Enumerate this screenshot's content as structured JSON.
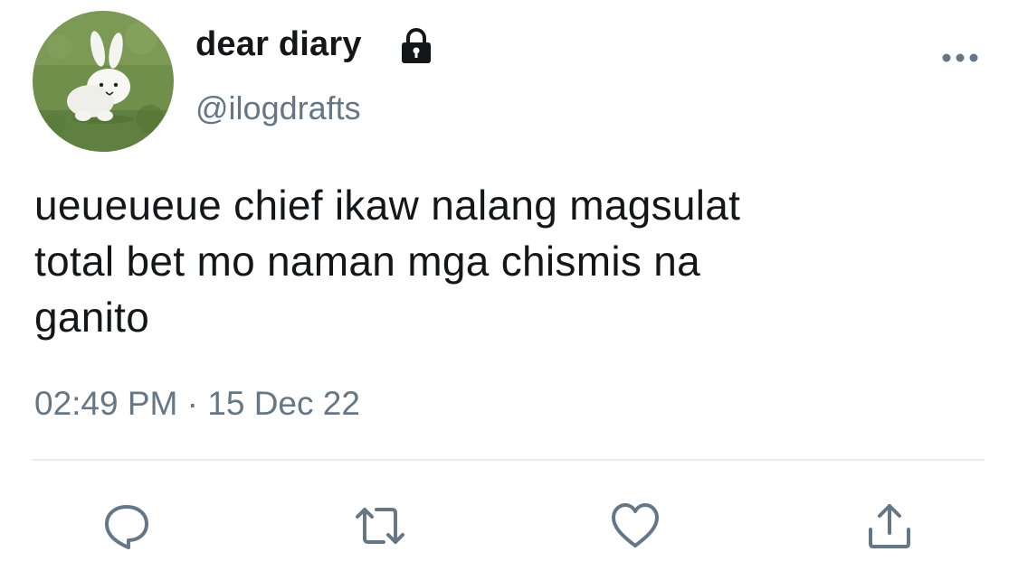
{
  "tweet": {
    "display_name": "dear diary",
    "handle": "@ilogdrafts",
    "text_lines": [
      "ueueueue chief ikaw nalang magsulat",
      "total bet mo naman mga chismis na",
      "ganito"
    ],
    "time": "02:49 PM",
    "separator": "·",
    "date": "15 Dec 22"
  },
  "icons": {
    "lock": "lock-icon",
    "more": "more-horizontal-icon",
    "reply": "reply-icon",
    "retweet": "retweet-icon",
    "like": "heart-icon",
    "share": "share-icon"
  },
  "colors": {
    "text": "#14171a",
    "secondary": "#657786",
    "divider": "#e6ecf0"
  }
}
